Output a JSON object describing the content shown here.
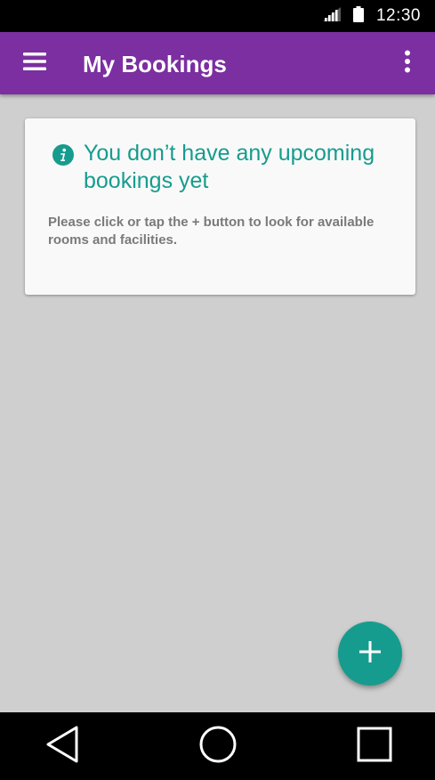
{
  "status_bar": {
    "time": "12:30",
    "icons": [
      "signal-icon",
      "battery-icon"
    ]
  },
  "app_bar": {
    "title": "My Bookings",
    "menu_icon": "hamburger-menu-icon",
    "overflow_icon": "more-vert-icon",
    "color": "#7b2fa0"
  },
  "empty_card": {
    "icon": "info-icon",
    "heading": "You don’t have any upcoming bookings yet",
    "body": "Please click or tap the + button to look for available rooms and facilities.",
    "accent": "#169c8e"
  },
  "fab": {
    "icon": "add-icon",
    "color": "#169c8e"
  },
  "nav_bar": {
    "buttons": [
      "back-icon",
      "home-icon",
      "recents-icon"
    ]
  }
}
